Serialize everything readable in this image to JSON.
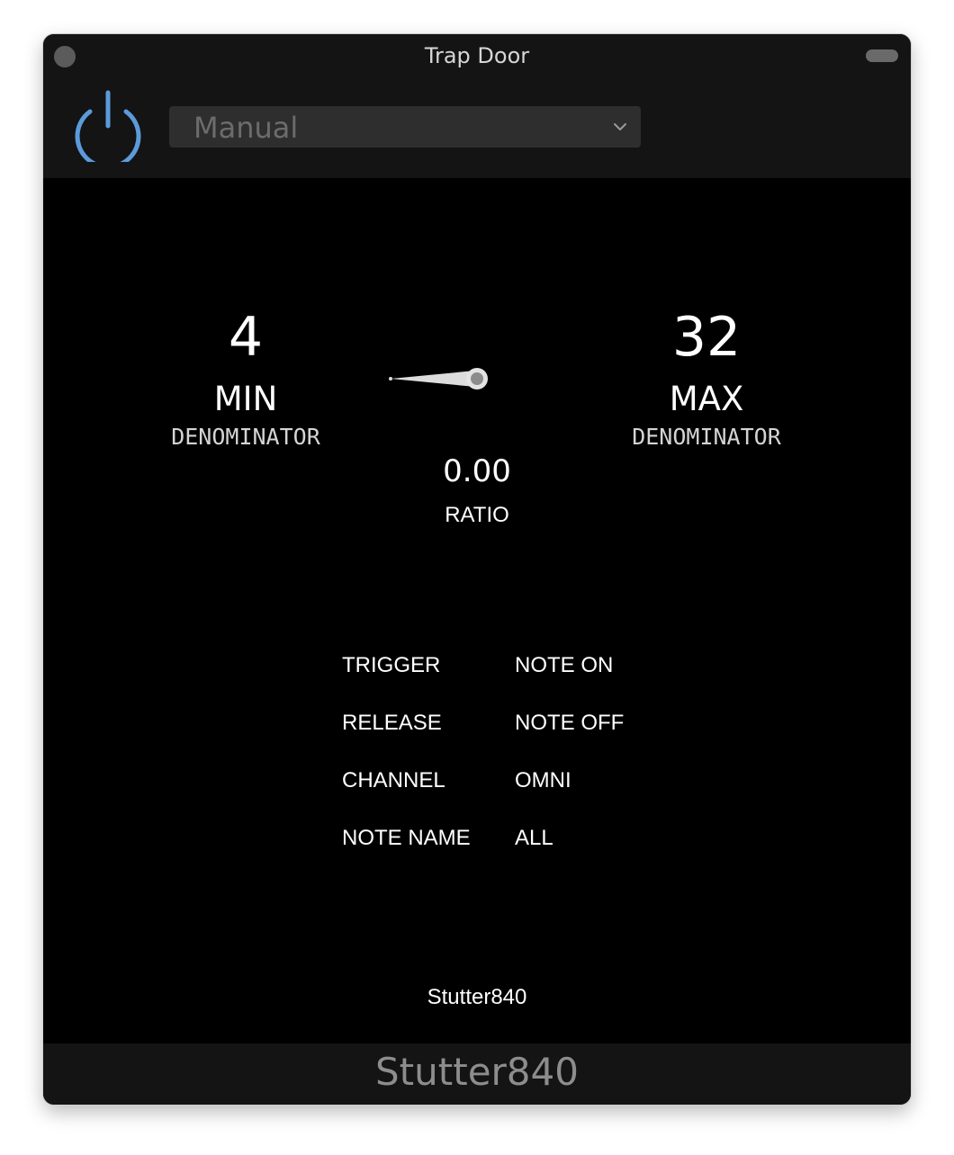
{
  "window": {
    "title": "Trap Door"
  },
  "toolbar": {
    "power_icon": "power-icon",
    "power_color": "#5b9bdb",
    "preset_value": "Manual",
    "preset_icon": "chevron-down-icon"
  },
  "params": {
    "min": {
      "value": "4",
      "name": "MIN",
      "sub": "DENOMINATOR"
    },
    "max": {
      "value": "32",
      "name": "MAX",
      "sub": "DENOMINATOR"
    },
    "ratio": {
      "value": "0.00",
      "label": "RATIO",
      "level": 0.0
    }
  },
  "settings": [
    {
      "key": "TRIGGER",
      "value": "NOTE ON"
    },
    {
      "key": "RELEASE",
      "value": "NOTE OFF"
    },
    {
      "key": "CHANNEL",
      "value": "OMNI"
    },
    {
      "key": "NOTE NAME",
      "value": "ALL"
    }
  ],
  "brand": "Stutter840",
  "footer": {
    "title": "Stutter840"
  }
}
